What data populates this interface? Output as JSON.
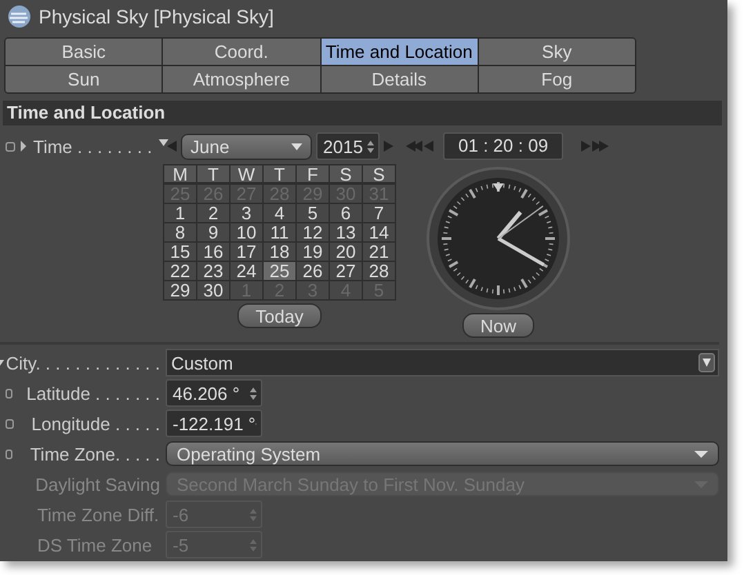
{
  "window": {
    "title": "Physical Sky [Physical Sky]"
  },
  "tabs": [
    [
      {
        "label": "Basic",
        "selected": false
      },
      {
        "label": "Coord.",
        "selected": false
      },
      {
        "label": "Time and Location",
        "selected": true
      },
      {
        "label": "Sky",
        "selected": false
      }
    ],
    [
      {
        "label": "Sun",
        "selected": false
      },
      {
        "label": "Atmosphere",
        "selected": false
      },
      {
        "label": "Details",
        "selected": false
      },
      {
        "label": "Fog",
        "selected": false
      }
    ]
  ],
  "section": "Time and Location",
  "time": {
    "label": "Time . . . . . . . .",
    "expanded": false,
    "keyframe": true,
    "month": "June",
    "year": "2015",
    "clock": "01 : 20 : 09",
    "today": "Today",
    "now": "Now"
  },
  "calendar": {
    "weekdays": [
      "M",
      "T",
      "W",
      "T",
      "F",
      "S",
      "S"
    ],
    "days": [
      {
        "label": "25",
        "in_month": false,
        "selected": false
      },
      {
        "label": "26",
        "in_month": false,
        "selected": false
      },
      {
        "label": "27",
        "in_month": false,
        "selected": false
      },
      {
        "label": "28",
        "in_month": false,
        "selected": false
      },
      {
        "label": "29",
        "in_month": false,
        "selected": false
      },
      {
        "label": "30",
        "in_month": false,
        "selected": false
      },
      {
        "label": "31",
        "in_month": false,
        "selected": false
      },
      {
        "label": "1",
        "in_month": true,
        "selected": false
      },
      {
        "label": "2",
        "in_month": true,
        "selected": false
      },
      {
        "label": "3",
        "in_month": true,
        "selected": false
      },
      {
        "label": "4",
        "in_month": true,
        "selected": false
      },
      {
        "label": "5",
        "in_month": true,
        "selected": false
      },
      {
        "label": "6",
        "in_month": true,
        "selected": false
      },
      {
        "label": "7",
        "in_month": true,
        "selected": false
      },
      {
        "label": "8",
        "in_month": true,
        "selected": false
      },
      {
        "label": "9",
        "in_month": true,
        "selected": false
      },
      {
        "label": "10",
        "in_month": true,
        "selected": false
      },
      {
        "label": "11",
        "in_month": true,
        "selected": false
      },
      {
        "label": "12",
        "in_month": true,
        "selected": false
      },
      {
        "label": "13",
        "in_month": true,
        "selected": false
      },
      {
        "label": "14",
        "in_month": true,
        "selected": false
      },
      {
        "label": "15",
        "in_month": true,
        "selected": false
      },
      {
        "label": "16",
        "in_month": true,
        "selected": false
      },
      {
        "label": "17",
        "in_month": true,
        "selected": false
      },
      {
        "label": "18",
        "in_month": true,
        "selected": false
      },
      {
        "label": "19",
        "in_month": true,
        "selected": false
      },
      {
        "label": "20",
        "in_month": true,
        "selected": false
      },
      {
        "label": "21",
        "in_month": true,
        "selected": false
      },
      {
        "label": "22",
        "in_month": true,
        "selected": false
      },
      {
        "label": "23",
        "in_month": true,
        "selected": false
      },
      {
        "label": "24",
        "in_month": true,
        "selected": false
      },
      {
        "label": "25",
        "in_month": true,
        "selected": true
      },
      {
        "label": "26",
        "in_month": true,
        "selected": false
      },
      {
        "label": "27",
        "in_month": true,
        "selected": false
      },
      {
        "label": "28",
        "in_month": true,
        "selected": false
      },
      {
        "label": "29",
        "in_month": true,
        "selected": false
      },
      {
        "label": "30",
        "in_month": true,
        "selected": false
      },
      {
        "label": "1",
        "in_month": false,
        "selected": false
      },
      {
        "label": "2",
        "in_month": false,
        "selected": false
      },
      {
        "label": "3",
        "in_month": false,
        "selected": false
      },
      {
        "label": "4",
        "in_month": false,
        "selected": false
      },
      {
        "label": "5",
        "in_month": false,
        "selected": false
      }
    ]
  },
  "fields": [
    {
      "kind": "city",
      "label": "City. . . . . . . . . . . . .",
      "value": "Custom",
      "expanded": true,
      "keyframe": false,
      "disabled": false
    },
    {
      "kind": "spinner",
      "label": "Latitude . . . . . . .",
      "value": "46.206 °",
      "keyframe": true,
      "disabled": false
    },
    {
      "kind": "spinner",
      "label": "Longitude . . . . .",
      "value": "-122.191 °",
      "keyframe": true,
      "disabled": false
    },
    {
      "kind": "dropdown",
      "label": "Time Zone. . . . .",
      "value": "Operating System",
      "keyframe": true,
      "disabled": false
    },
    {
      "kind": "dropdown",
      "label": "Daylight Saving",
      "value": "Second March Sunday to First Nov. Sunday",
      "keyframe": false,
      "disabled": true
    },
    {
      "kind": "spinner",
      "label": "Time Zone Diff.",
      "value": "-6",
      "keyframe": false,
      "disabled": true
    },
    {
      "kind": "spinner",
      "label": "DS Time Zone",
      "value": "-5",
      "keyframe": false,
      "disabled": true
    }
  ]
}
